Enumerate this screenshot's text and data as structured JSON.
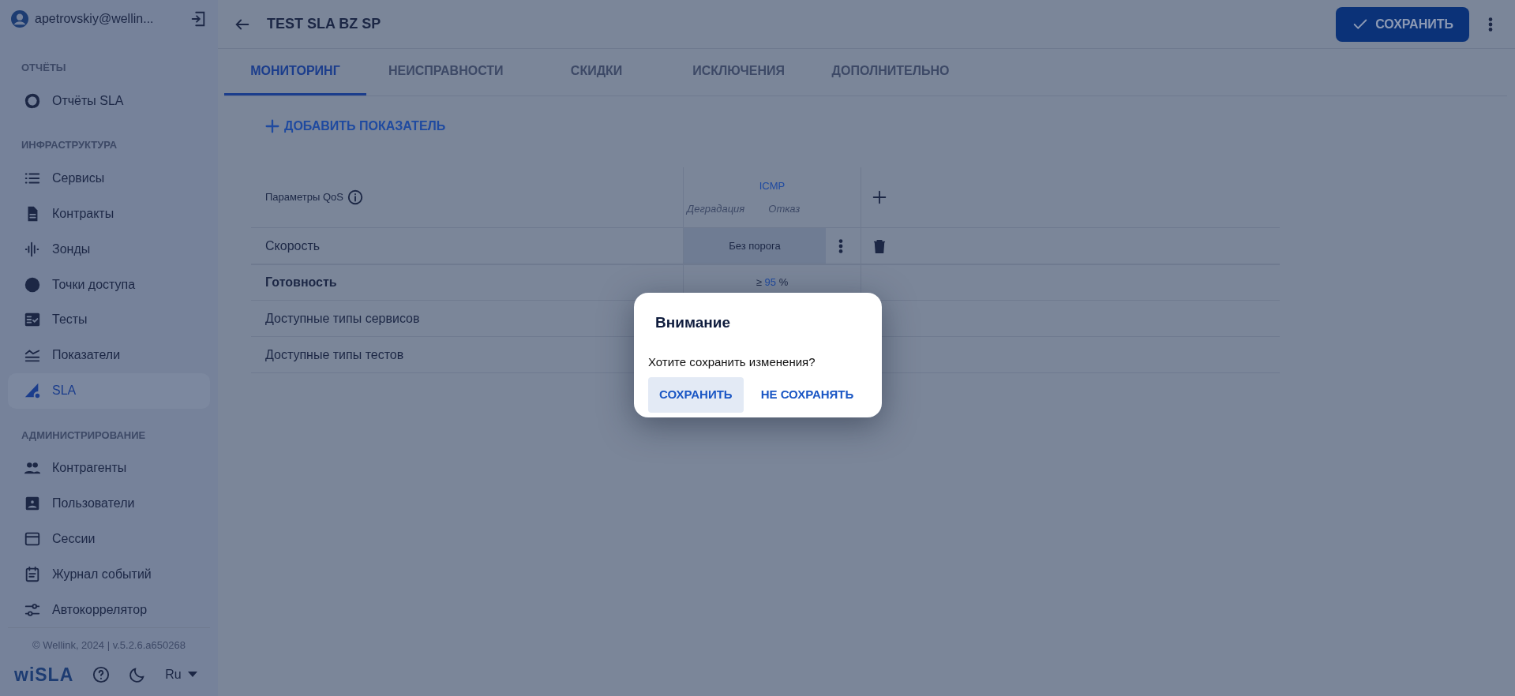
{
  "user": {
    "email": "apetrovskiy@wellin..."
  },
  "sidebar": {
    "sections": [
      {
        "title": "ОТЧЁТЫ",
        "items": [
          {
            "label": "Отчёты SLA",
            "selected": false
          }
        ]
      },
      {
        "title": "ИНФРАСТРУКТУРА",
        "items": [
          {
            "label": "Сервисы",
            "selected": false
          },
          {
            "label": "Контракты",
            "selected": false
          },
          {
            "label": "Зонды",
            "selected": false
          },
          {
            "label": "Точки доступа",
            "selected": false
          },
          {
            "label": "Тесты",
            "selected": false
          },
          {
            "label": "Показатели",
            "selected": false
          },
          {
            "label": "SLA",
            "selected": true
          }
        ]
      },
      {
        "title": "АДМИНИСТРИРОВАНИЕ",
        "items": [
          {
            "label": "Контрагенты",
            "selected": false
          },
          {
            "label": "Пользователи",
            "selected": false
          },
          {
            "label": "Сессии",
            "selected": false
          },
          {
            "label": "Журнал событий",
            "selected": false
          },
          {
            "label": "Автокоррелятор",
            "selected": false
          }
        ]
      }
    ],
    "copyright": "© Wellink, 2024 | v.5.2.6.a650268",
    "logo": "wiSLA",
    "language": "Ru"
  },
  "header": {
    "title": "TEST SLA BZ SP",
    "save_label": "СОХРАНИТЬ"
  },
  "tabs": [
    {
      "label": "МОНИТОРИНГ",
      "selected": true
    },
    {
      "label": "НЕИСПРАВНОСТИ",
      "selected": false
    },
    {
      "label": "СКИДКИ",
      "selected": false
    },
    {
      "label": "ИСКЛЮЧЕНИЯ",
      "selected": false
    },
    {
      "label": "ДОПОЛНИТЕЛЬНО",
      "selected": false
    }
  ],
  "add_metric": "ДОБАВИТЬ ПОКАЗАТЕЛЬ",
  "table": {
    "qos_header": "Параметры QoS",
    "group": "ICMP",
    "subcolumns": [
      "Деградация",
      "Отказ"
    ],
    "rows": [
      {
        "name": "Скорость",
        "kind": "threshold",
        "value": "Без порога"
      },
      {
        "name": "Готовность",
        "kind": "percent",
        "prefix": "≥",
        "number": "95",
        "suffix": "%"
      },
      {
        "name": "Доступные типы сервисов",
        "kind": "plain"
      },
      {
        "name": "Доступные типы тестов",
        "kind": "plain"
      }
    ]
  },
  "dialog": {
    "title": "Внимание",
    "message": "Хотите сохранить изменения?",
    "buttons": [
      {
        "label": "СОХРАНИТЬ",
        "kind": "tonal"
      },
      {
        "label": "НЕ СОХРАНЯТЬ",
        "kind": "text"
      }
    ]
  }
}
